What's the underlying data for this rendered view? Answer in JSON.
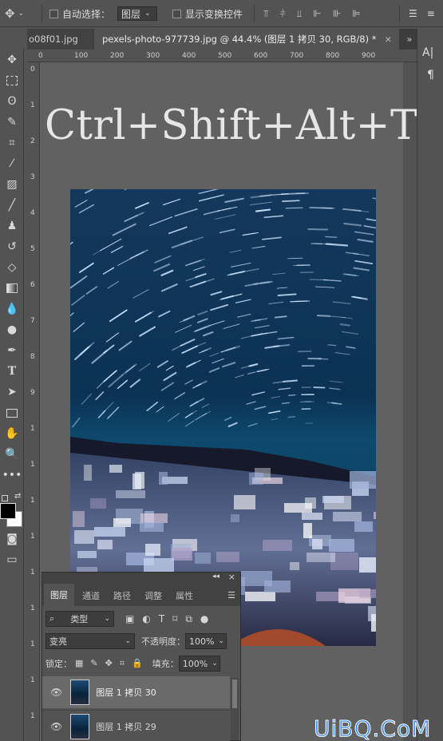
{
  "options_bar": {
    "auto_select_label": "自动选择：",
    "auto_select_value": "图层",
    "show_transform_label": "显示变换控件"
  },
  "tabs": [
    {
      "label": "o08f01.jpg"
    },
    {
      "label": "pexels-photo-977739.jpg @ 44.4% (图层 1 拷贝 30, RGB/8) *"
    }
  ],
  "ruler_top": [
    "0",
    "100",
    "200",
    "300",
    "400",
    "500",
    "600",
    "700",
    "800",
    "900"
  ],
  "ruler_left": [
    "0",
    "1",
    "2",
    "3",
    "4",
    "5",
    "6",
    "7",
    "8",
    "9",
    "1",
    "1",
    "1",
    "1",
    "1",
    "1",
    "1",
    "1",
    "1"
  ],
  "canvas": {
    "shortcut_text": "Ctrl+Shift+Alt+T"
  },
  "layers_panel": {
    "tabs": [
      "图层",
      "通道",
      "路径",
      "调整",
      "属性"
    ],
    "filter_kind": "类型",
    "blend_mode": "变亮",
    "opacity_label": "不透明度：",
    "opacity_value": "100%",
    "lock_label": "锁定：",
    "fill_label": "填充：",
    "fill_value": "100%",
    "layers": [
      {
        "name": "图层 1 拷贝 30"
      },
      {
        "name": "图层 1 拷贝 29"
      }
    ]
  },
  "watermark": "UiBQ.CoM",
  "colors": {
    "accent": "#2f8cff",
    "panel": "#535353",
    "canvas": "#616161"
  }
}
